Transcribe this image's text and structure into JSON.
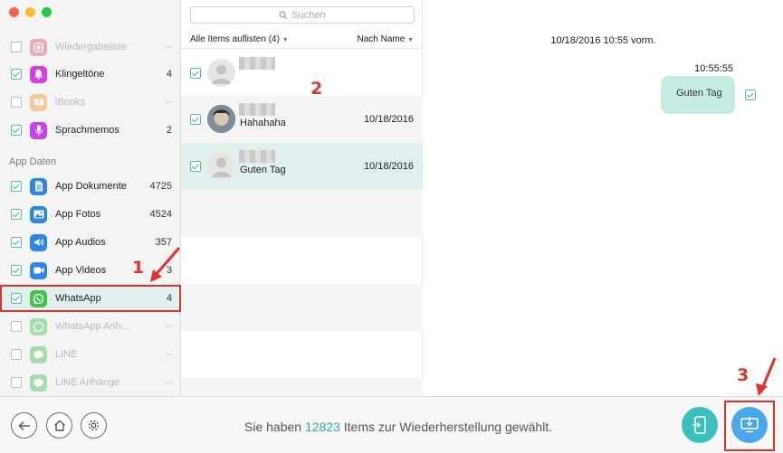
{
  "sidebar": {
    "section_app_data": "App Daten",
    "items": [
      {
        "label": "Wiedergabeliste",
        "count": "--",
        "checked": false,
        "dim": true,
        "icon": "playlist-icon",
        "color": "#e0566f"
      },
      {
        "label": "Klingeltöne",
        "count": "4",
        "checked": true,
        "dim": false,
        "icon": "bell-icon",
        "color": "#d83ee4"
      },
      {
        "label": "iBooks",
        "count": "--",
        "checked": false,
        "dim": true,
        "icon": "book-icon",
        "color": "#f39a26"
      },
      {
        "label": "Sprachmemos",
        "count": "2",
        "checked": true,
        "dim": false,
        "icon": "microphone-icon",
        "color": "#c844e8"
      },
      {
        "label": "App Dokumente",
        "count": "4725",
        "checked": true,
        "dim": false,
        "icon": "document-icon",
        "color": "#2e86e6"
      },
      {
        "label": "App Fotos",
        "count": "4524",
        "checked": true,
        "dim": false,
        "icon": "photo-icon",
        "color": "#2e86e6"
      },
      {
        "label": "App Audios",
        "count": "357",
        "checked": true,
        "dim": false,
        "icon": "speaker-icon",
        "color": "#2e86e6"
      },
      {
        "label": "App Videos",
        "count": "3",
        "checked": true,
        "dim": false,
        "icon": "video-icon",
        "color": "#2e86e6"
      },
      {
        "label": "WhatsApp",
        "count": "4",
        "checked": true,
        "dim": false,
        "icon": "whatsapp-icon",
        "color": "#44c24f"
      },
      {
        "label": "WhatsApp Anh…",
        "count": "--",
        "checked": false,
        "dim": true,
        "icon": "whatsapp-attach-icon",
        "color": "#44c24f"
      },
      {
        "label": "LINE",
        "count": "--",
        "checked": false,
        "dim": true,
        "icon": "line-icon",
        "color": "#44c24f"
      },
      {
        "label": "LINE Anhänge",
        "count": "--",
        "checked": false,
        "dim": true,
        "icon": "line-attach-icon",
        "color": "#44c24f"
      }
    ]
  },
  "list": {
    "search_placeholder": "Suchen",
    "filter_label": "Alle Items auflisten (4)",
    "sort_label": "Nach Name",
    "rows": [
      {
        "text": "",
        "date": ""
      },
      {
        "text": "Hahahaha",
        "date": "10/18/2016"
      },
      {
        "text": "Guten Tag",
        "date": "10/18/2016"
      }
    ]
  },
  "conversation": {
    "header_date": "10/18/2016 10:55 vorm.",
    "message_time": "10:55:55",
    "message_text": "Guten Tag"
  },
  "footer": {
    "status_prefix": "Sie haben",
    "status_count": "12823",
    "status_suffix": "Items zur Wiederherstellung gewählt."
  },
  "markers": {
    "one": "1",
    "two": "2",
    "three": "3"
  },
  "colors": {
    "accent": "#3aa6a0",
    "highlight": "#dff0ee",
    "annotation": "#e0322b",
    "bubble": "#c5ebe3"
  }
}
